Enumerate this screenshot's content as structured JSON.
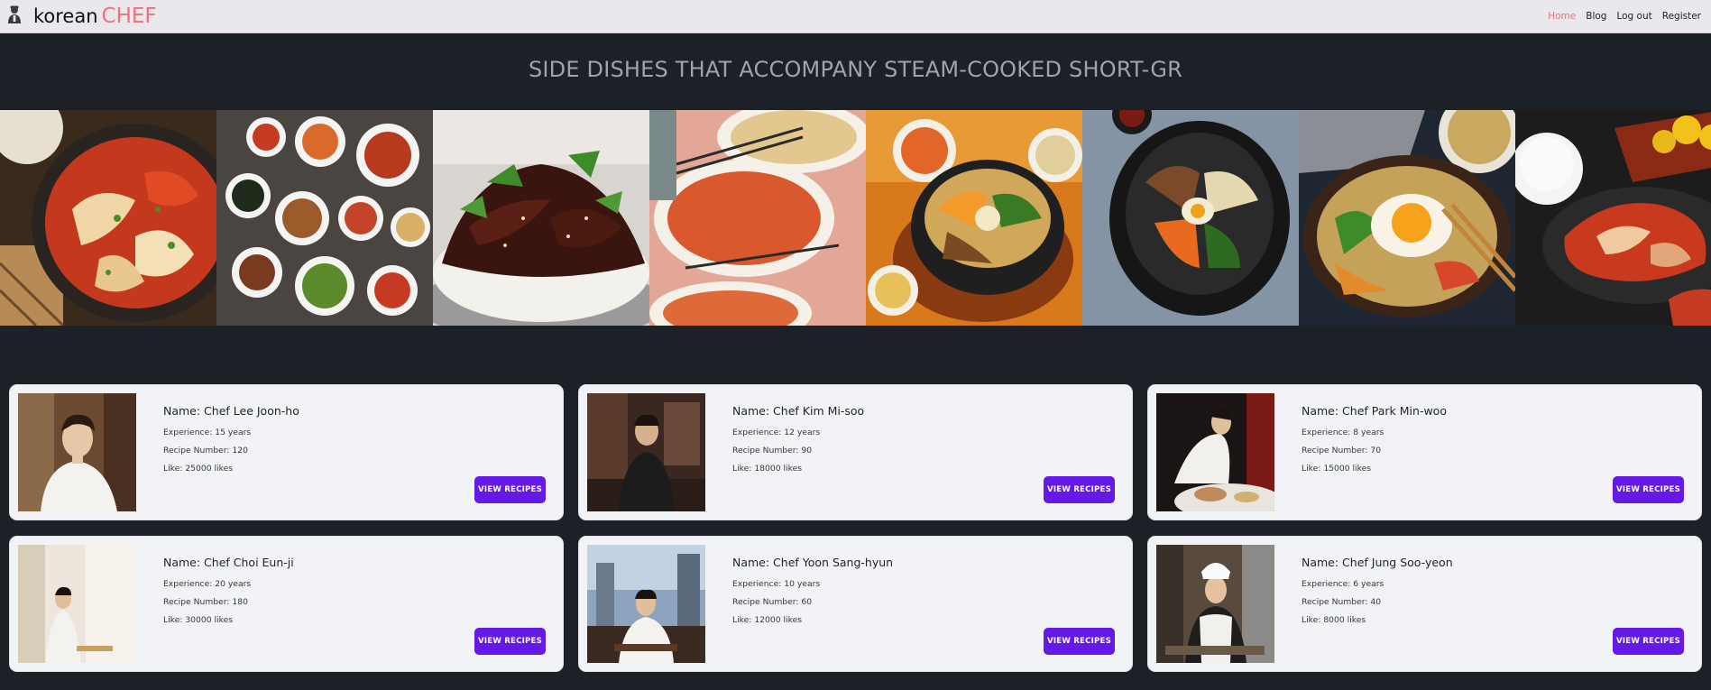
{
  "nav": {
    "brand_text": "korean",
    "brand_accent": "CHEF",
    "brand_icon": "chef-icon",
    "links": [
      {
        "label": "Home",
        "active": true
      },
      {
        "label": "Blog",
        "active": false
      },
      {
        "label": "Log out",
        "active": false
      },
      {
        "label": "Register",
        "active": false
      }
    ]
  },
  "page_title": "SIDE DISHES THAT ACCOMPANY STEAM-COOKED SHORT-GR",
  "colors": {
    "accent": "#f06e81",
    "button": "#6419e6",
    "background": "#1c2128",
    "card": "#f2f3f6"
  },
  "gallery": [
    {
      "name": "kimchi-dish"
    },
    {
      "name": "banchan-spread"
    },
    {
      "name": "jjajangbap"
    },
    {
      "name": "noodle-table"
    },
    {
      "name": "bibimbap-stone-bowl"
    },
    {
      "name": "bibimbap-black-pot"
    },
    {
      "name": "egg-bibimbap"
    },
    {
      "name": "kimchi-tray"
    }
  ],
  "chefs": [
    {
      "name": "Name: Chef Lee Joon-ho",
      "experience": "Experience: 15 years",
      "recipes": "Recipe Number: 120",
      "likes": "Like: 25000 likes",
      "button": "VIEW RECIPES"
    },
    {
      "name": "Name: Chef Kim Mi-soo",
      "experience": "Experience: 12 years",
      "recipes": "Recipe Number: 90",
      "likes": "Like: 18000 likes",
      "button": "VIEW RECIPES"
    },
    {
      "name": "Name: Chef Park Min-woo",
      "experience": "Experience: 8 years",
      "recipes": "Recipe Number: 70",
      "likes": "Like: 15000 likes",
      "button": "VIEW RECIPES"
    },
    {
      "name": "Name: Chef Choi Eun-ji",
      "experience": "Experience: 20 years",
      "recipes": "Recipe Number: 180",
      "likes": "Like: 30000 likes",
      "button": "VIEW RECIPES"
    },
    {
      "name": "Name: Chef Yoon Sang-hyun",
      "experience": "Experience: 10 years",
      "recipes": "Recipe Number: 60",
      "likes": "Like: 12000 likes",
      "button": "VIEW RECIPES"
    },
    {
      "name": "Name: Chef Jung Soo-yeon",
      "experience": "Experience: 6 years",
      "recipes": "Recipe Number: 40",
      "likes": "Like: 8000 likes",
      "button": "VIEW RECIPES"
    }
  ]
}
